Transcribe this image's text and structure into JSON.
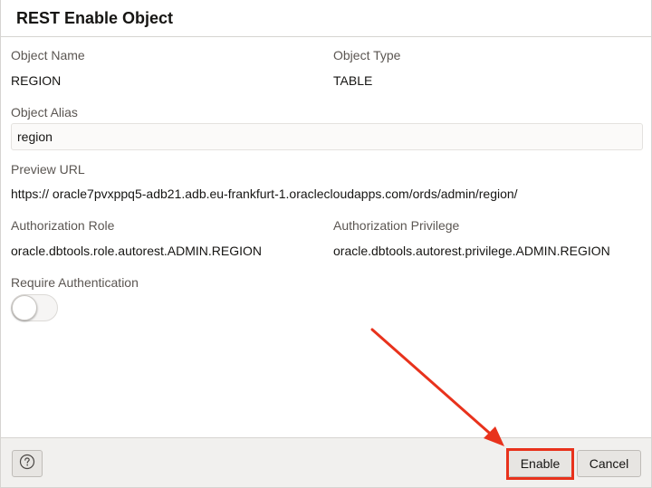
{
  "dialog": {
    "title": "REST Enable Object"
  },
  "fields": {
    "object_name_label": "Object Name",
    "object_name_value": "REGION",
    "object_type_label": "Object Type",
    "object_type_value": "TABLE",
    "object_alias_label": "Object Alias",
    "object_alias_value": "region",
    "preview_url_label": "Preview URL",
    "preview_url_value": "https:// oracle7pvxppq5-adb21.adb.eu-frankfurt-1.oraclecloudapps.com/ords/admin/region/",
    "auth_role_label": "Authorization Role",
    "auth_role_value": "oracle.dbtools.role.autorest.ADMIN.REGION",
    "auth_privilege_label": "Authorization Privilege",
    "auth_privilege_value": "oracle.dbtools.autorest.privilege.ADMIN.REGION",
    "require_auth_label": "Require Authentication",
    "require_auth_enabled": false
  },
  "footer": {
    "help_icon": "question-circle-icon",
    "enable_label": "Enable",
    "cancel_label": "Cancel"
  },
  "annotation": {
    "highlight_color": "#e8321c",
    "target": "enable-button"
  }
}
